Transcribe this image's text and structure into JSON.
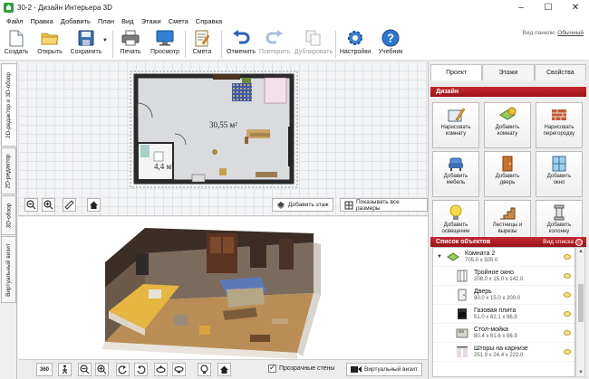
{
  "window": {
    "title": "30-2 - Дизайн Интерьера 3D",
    "minimize": "–",
    "maximize": "☐",
    "close": "✕"
  },
  "menu": [
    "Файл",
    "Правка",
    "Добавить",
    "План",
    "Вид",
    "Этажи",
    "Смета",
    "Справка"
  ],
  "toolbar": {
    "create": "Создать",
    "open": "Открыть",
    "save": "Сохранить",
    "print": "Печать",
    "preview": "Просмотр",
    "estimate": "Смета",
    "undo": "Отменить",
    "redo": "Повторить",
    "duplicate": "Дублировать",
    "settings": "Настройки",
    "tutorial": "Учебник",
    "view_panel_label": "Вид панели:",
    "view_panel_value": "Обычный"
  },
  "left_tabs": [
    "2D-редактор и 3D-обзор",
    "2D-редактор",
    "3D-обзор",
    "Виртуальный визит"
  ],
  "plan": {
    "room_area": "30,55 м²",
    "small_room_area": "4,4 м²",
    "add_floor": "Добавить этаж",
    "show_dimensions": "Показывать все размеры"
  },
  "right_panel": {
    "tabs": [
      "Проект",
      "Этажи",
      "Свойства"
    ],
    "design_header": "Дизайн",
    "design_buttons": [
      {
        "label": "Нарисовать\nкомнату",
        "icon": "draw-room-icon"
      },
      {
        "label": "Добавить\nкомнату",
        "icon": "add-room-icon"
      },
      {
        "label": "Нарисовать\nперегородку",
        "icon": "draw-partition-icon"
      },
      {
        "label": "Добавить\nмебель",
        "icon": "add-furniture-icon"
      },
      {
        "label": "Добавить\nдверь",
        "icon": "add-door-icon"
      },
      {
        "label": "Добавить\nокно",
        "icon": "add-window-icon"
      },
      {
        "label": "Добавить\nосвещение",
        "icon": "add-lighting-icon"
      },
      {
        "label": "Лестницы и\nвырезы",
        "icon": "stairs-icon"
      },
      {
        "label": "Добавить\nколонну",
        "icon": "add-column-icon"
      }
    ],
    "objects_header": "Список объектов",
    "list_view": "Вид списка",
    "objects": [
      {
        "name": "Комната 2",
        "dims": "705.0 x 505.0",
        "icon": "room-icon",
        "indent": false
      },
      {
        "name": "Тройное окно",
        "dims": "208.0 x 15.0 x 142.0",
        "icon": "window-icon",
        "indent": true
      },
      {
        "name": "Дверь",
        "dims": "90.0 x 15.0 x 200.0",
        "icon": "door-icon",
        "indent": true
      },
      {
        "name": "Газовая плита",
        "dims": "51.0 x 62.1 x 86.9",
        "icon": "stove-icon",
        "indent": true
      },
      {
        "name": "Стол-мойка",
        "dims": "80.4 x 61.6 x 86.9",
        "icon": "sink-icon",
        "indent": true
      },
      {
        "name": "Шторы на карнизе",
        "dims": "251.9 x 24.4 x 222.0",
        "icon": "curtain-icon",
        "indent": true
      }
    ]
  },
  "bottom": {
    "transparent_walls": "Прозрачные стены",
    "virtual_visit": "Виртуальный визит",
    "deg360": "360"
  }
}
